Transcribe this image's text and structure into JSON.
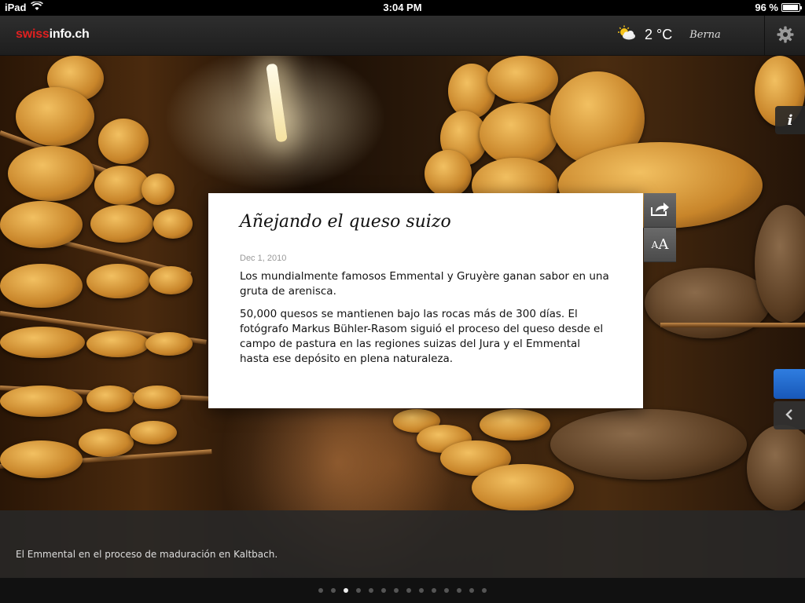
{
  "status_bar": {
    "device": "iPad",
    "time": "3:04 PM",
    "battery": "96 %",
    "battery_level": 0.96
  },
  "header": {
    "logo_red": "swiss",
    "logo_white": "info.ch",
    "weather": {
      "icon": "partly-sunny-icon",
      "temperature": "2 °C",
      "city": "Berna"
    },
    "settings_icon": "gear-icon"
  },
  "side": {
    "info_label": "i",
    "back_icon": "chevron-left-icon"
  },
  "article": {
    "title": "Añejando el queso suizo",
    "date": "Dec 1, 2010",
    "lead": "Los mundialmente famosos Emmental y Gruyère ganan sabor en una gruta de arenisca.",
    "body": "50,000 quesos se mantienen bajo las rocas más de 300 días. El fotógrafo Markus Bühler-Rasom siguió el proceso del queso desde el campo de pastura en las regiones suizas del Jura y el Emmental hasta ese depósito en plena naturaleza."
  },
  "tools": {
    "share_icon": "share-icon",
    "font_small": "A",
    "font_big": "A"
  },
  "caption": "El Emmental en el proceso de maduración en Kaltbach.",
  "pager": {
    "total": 14,
    "current": 3
  },
  "colors": {
    "brand_red": "#e02020",
    "tab_blue": "#2f7de0"
  }
}
